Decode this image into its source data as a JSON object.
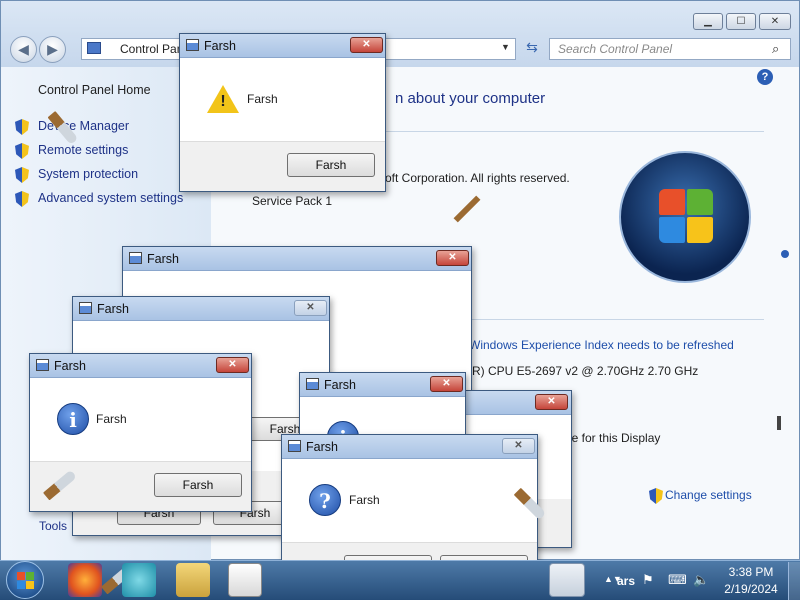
{
  "window": {
    "minimize_label": "▁",
    "maximize_label": "☐",
    "close_label": "✕",
    "back_icon": "back-arrow-icon",
    "forward_icon": "forward-arrow-icon",
    "address": "Control Pane",
    "search_placeholder": "Search Control Panel"
  },
  "sidebar": {
    "home": "Control Panel Home",
    "items": [
      {
        "label": "Device Manager"
      },
      {
        "label": "Remote settings"
      },
      {
        "label": "System protection"
      },
      {
        "label": "Advanced system settings"
      }
    ],
    "see_also_tail": "Tools"
  },
  "content": {
    "heading_tail": "n about your computer",
    "copyright_tail": "oft Corporation.  All rights reserved.",
    "service_pack": "Service Pack 1",
    "experience_link": "Windows Experience Index needs to be refreshed",
    "cpu": "R) CPU E5-2697 v2 @ 2.70GHz   2.70 GHz",
    "display": "le for this Display",
    "change_settings": "Change settings"
  },
  "dialogs": {
    "title": "Farsh",
    "message": "Farsh",
    "button": "Farsh"
  },
  "taskbar": {
    "time": "3:38 PM",
    "date": "2/19/2024",
    "label_fragment": "ars"
  },
  "colors": {
    "link": "#1e4eaa",
    "close_red": "#c5453a",
    "title_blue": "#a9c3e4"
  }
}
